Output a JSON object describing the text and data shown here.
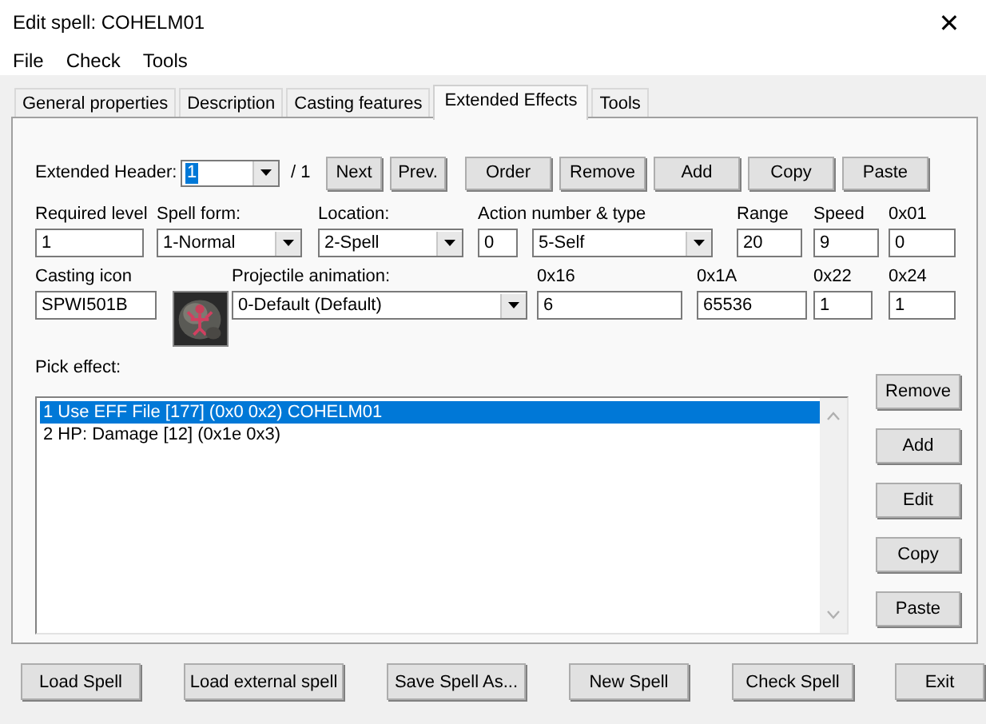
{
  "window": {
    "title": "Edit spell: COHELM01",
    "close": "✕"
  },
  "menu": [
    "File",
    "Check",
    "Tools"
  ],
  "tabs": [
    {
      "label": "General properties",
      "selected": false
    },
    {
      "label": "Description",
      "selected": false
    },
    {
      "label": "Casting features",
      "selected": false
    },
    {
      "label": "Extended Effects",
      "selected": true
    },
    {
      "label": "Tools",
      "selected": false
    }
  ],
  "header": {
    "label": "Extended Header:",
    "value": "1",
    "highlighted": true,
    "count": "/  1",
    "nav_buttons": [
      "Next",
      "Prev."
    ],
    "buttons": [
      "Order",
      "Remove",
      "Add",
      "Copy",
      "Paste"
    ]
  },
  "field_rows": [
    [
      {
        "label": "Required level",
        "controls": [
          {
            "kind": "text",
            "value": "1"
          }
        ]
      },
      {
        "label": "Spell form:",
        "controls": [
          {
            "kind": "combo",
            "value": "1-Normal"
          }
        ]
      },
      {
        "label": "Location:",
        "controls": [
          {
            "kind": "combo",
            "value": "2-Spell"
          }
        ]
      },
      {
        "label": "Action number & type",
        "controls": [
          {
            "kind": "text",
            "value": "0"
          },
          {
            "kind": "combo",
            "value": "5-Self"
          }
        ]
      },
      {
        "label": "Range",
        "controls": [
          {
            "kind": "text",
            "value": "20"
          }
        ]
      },
      {
        "label": "Speed",
        "controls": [
          {
            "kind": "text",
            "value": "9"
          }
        ]
      },
      {
        "label": "0x01",
        "controls": [
          {
            "kind": "text",
            "value": "0"
          }
        ]
      }
    ],
    [
      {
        "label": "Casting icon",
        "controls": [
          {
            "kind": "text",
            "value": "SPWI501B"
          },
          {
            "kind": "picture"
          }
        ]
      },
      {
        "label": "Projectile animation:",
        "controls": [
          {
            "kind": "combo",
            "value": "0-Default (Default)"
          }
        ]
      },
      {
        "label": "0x16",
        "controls": [
          {
            "kind": "text",
            "value": "6"
          }
        ]
      },
      {
        "label": "0x1A",
        "controls": [
          {
            "kind": "text",
            "value": "65536"
          }
        ]
      },
      {
        "label": "0x22",
        "controls": [
          {
            "kind": "text",
            "value": "1"
          }
        ]
      },
      {
        "label": "0x24",
        "controls": [
          {
            "kind": "text",
            "value": "1"
          }
        ]
      }
    ]
  ],
  "effects": {
    "label": "Pick effect:",
    "items": [
      {
        "text": "1 Use EFF File [177] (0x0 0x2) COHELM01",
        "selected": true
      },
      {
        "text": "2 HP: Damage [12] (0x1e 0x3)",
        "selected": false
      }
    ],
    "buttons": [
      "Remove",
      "Add",
      "Edit",
      "Copy",
      "Paste"
    ]
  },
  "bottom_buttons": [
    "Load Spell",
    "Load external spell",
    "Save Spell As...",
    "New Spell",
    "Check Spell",
    "Exit"
  ]
}
